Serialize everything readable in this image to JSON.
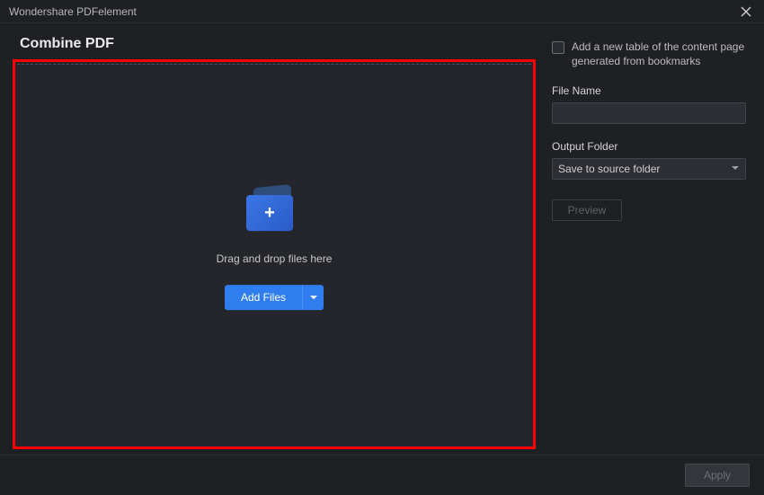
{
  "titlebar": {
    "app_name": "Wondershare PDFelement"
  },
  "heading": "Combine PDF",
  "dropzone": {
    "hint": "Drag and drop files here",
    "add_files_label": "Add Files"
  },
  "sidebar": {
    "checkbox_label": "Add a new table of the content page generated from bookmarks",
    "filename_label": "File Name",
    "filename_value": "",
    "output_label": "Output Folder",
    "output_selected": "Save to source folder",
    "preview_label": "Preview"
  },
  "footer": {
    "apply_label": "Apply"
  }
}
